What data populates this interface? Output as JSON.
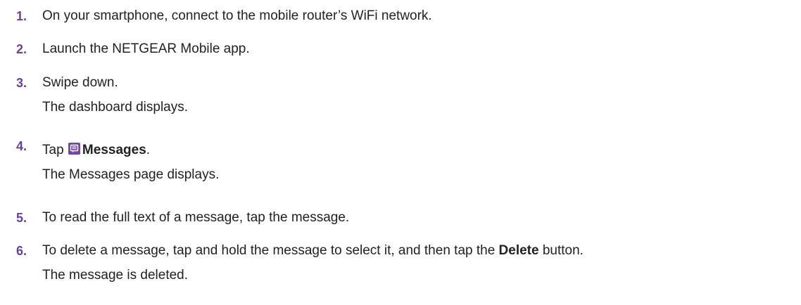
{
  "steps": [
    {
      "number": "1.",
      "text": "On your smartphone, connect to the mobile router’s WiFi network."
    },
    {
      "number": "2.",
      "text": "Launch the NETGEAR Mobile app."
    },
    {
      "number": "3.",
      "text": "Swipe down.",
      "result": "The dashboard displays."
    },
    {
      "number": "4.",
      "prefix": "Tap",
      "bold": "Messages",
      "suffix": ".",
      "icon": "messages-icon",
      "result": "The Messages page displays."
    },
    {
      "number": "5.",
      "text": "To read the full text of a message, tap the message."
    },
    {
      "number": "6.",
      "prefix": "To delete a message, tap and hold the message to select it, and then tap the",
      "bold": "Delete",
      "suffix": "button.",
      "result": "The message is deleted."
    }
  ],
  "colors": {
    "step_number": "#6b3fa0",
    "icon_bg": "#7a3fb0",
    "text": "#222222"
  }
}
